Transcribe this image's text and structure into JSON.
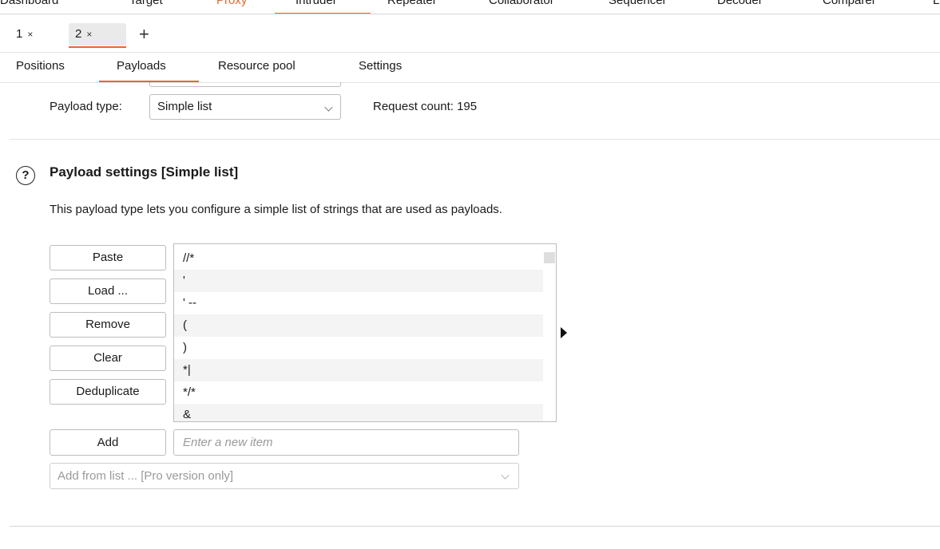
{
  "top_nav": {
    "tabs": [
      {
        "label": "Dashboard"
      },
      {
        "label": "Target"
      },
      {
        "label": "Proxy"
      },
      {
        "label": "Intruder"
      },
      {
        "label": "Repeater"
      },
      {
        "label": "Collaborator"
      },
      {
        "label": "Sequencer"
      },
      {
        "label": "Decoder"
      },
      {
        "label": "Comparer"
      },
      {
        "label": "L"
      }
    ],
    "accent_color": "#e8662f"
  },
  "attack_tabs": {
    "tabs": [
      {
        "label": "1",
        "close": "×"
      },
      {
        "label": "2",
        "close": "×"
      }
    ],
    "add_symbol": "+"
  },
  "section_tabs": [
    "Positions",
    "Payloads",
    "Resource pool",
    "Settings"
  ],
  "payload_type": {
    "label": "Payload type:",
    "value": "Simple list",
    "request_count_label": "Request count: 195"
  },
  "payload_settings": {
    "help_symbol": "?",
    "title": "Payload settings [Simple list]",
    "description": "This payload type lets you configure a simple list of strings that are used as payloads.",
    "buttons": {
      "paste": "Paste",
      "load": "Load ...",
      "remove": "Remove",
      "clear": "Clear",
      "deduplicate": "Deduplicate",
      "add": "Add"
    },
    "list_items": [
      "//*",
      "'",
      "' --",
      "(",
      ")",
      "*|",
      "*/*",
      "&"
    ],
    "add_input_placeholder": "Enter a new item",
    "add_from_list": "Add from list ... [Pro version only]"
  },
  "icons": {
    "help": "question-circle-icon",
    "expand": "triangle-right-icon",
    "dropdown": "chevron-down-icon"
  }
}
